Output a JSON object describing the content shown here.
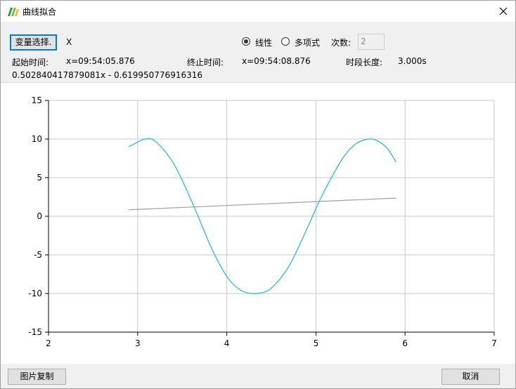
{
  "window": {
    "title": "曲线拟合"
  },
  "toolbar": {
    "variable_button": "变量选择.",
    "variable_value": "X",
    "radio_linear": "线性",
    "radio_poly": "多项式",
    "degree_label": "次数:",
    "degree_value": "2",
    "selected_mode": "linear",
    "start_label": "起始时间:",
    "start_value": "x=09:54:05.876",
    "end_label": "终止时间:",
    "end_value": "x=09:54:08.876",
    "duration_label": "时段长度:",
    "duration_value": "3.000s",
    "equation": "0.502840417879081x - 0.619950776916316"
  },
  "footer": {
    "copy_button": "图片复制",
    "cancel_button": "取消"
  },
  "colors": {
    "sine": "#1eb4e6",
    "fit": "#a0a0a0",
    "grid": "#c8c8c8",
    "accent": "#0078d7"
  },
  "icons": {
    "app": "app-logo-icon",
    "close": "close-icon"
  },
  "chart_data": {
    "type": "line",
    "xlim": [
      2,
      7
    ],
    "ylim": [
      -15,
      15
    ],
    "x_ticks": [
      2,
      3,
      4,
      5,
      6,
      7
    ],
    "y_ticks": [
      15,
      10,
      5,
      0,
      -5,
      -10,
      -15
    ],
    "grid": true,
    "series": [
      {
        "x": [
          2.9,
          3.0,
          3.09,
          3.2,
          3.4,
          3.6,
          3.8,
          3.9,
          4.0,
          4.1,
          4.2,
          4.34,
          4.5,
          4.7,
          4.9,
          5.0,
          5.1,
          5.3,
          5.45,
          5.6,
          5.7,
          5.8,
          5.9
        ],
        "y": [
          9.0,
          9.6,
          10.0,
          9.7,
          6.9,
          2.1,
          -3.4,
          -5.8,
          -7.8,
          -9.1,
          -9.8,
          -10.0,
          -9.3,
          -6.4,
          -1.6,
          1.0,
          3.4,
          7.5,
          9.4,
          10.0,
          9.7,
          8.8,
          7.0
        ]
      },
      {
        "x": [
          2.9,
          5.9
        ],
        "y": [
          0.84,
          2.35
        ]
      }
    ]
  }
}
